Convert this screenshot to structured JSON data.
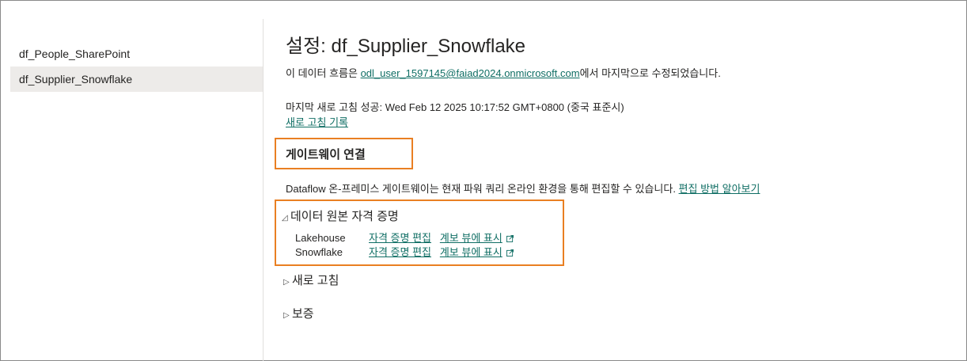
{
  "sidebar": {
    "items": [
      {
        "label": "df_People_SharePoint"
      },
      {
        "label": "df_Supplier_Snowflake"
      }
    ]
  },
  "main": {
    "title_prefix": "설정",
    "title_sep": ":",
    "title_name": "df_Supplier_Snowflake",
    "modified_pre": "이 데이터 흐름은 ",
    "modified_user": "odl_user_1597145@faiad2024.onmicrosoft.com",
    "modified_post": "에서 마지막으로 수정되었습니다.",
    "last_refresh": "마지막 새로 고침 성공: Wed Feb 12 2025 10:17:52 GMT+0800 (중국 표준시)",
    "refresh_history_link": "새로 고침 기록"
  },
  "gateway": {
    "title": "게이트웨이 연결",
    "desc": "Dataflow 온-프레미스 게이트웨이는 현재 파워 쿼리 온라인 환경을 통해 편집할 수 있습니다. ",
    "learn_link": "편집 방법 알아보기"
  },
  "credentials": {
    "header": "데이터 원본 자격 증명",
    "toggle": "◿",
    "rows": [
      {
        "name": "Lakehouse",
        "edit": "자격 증명 편집",
        "lineage": "계보 뷰에 표시"
      },
      {
        "name": "Snowflake",
        "edit": "자격 증명 편집",
        "lineage": "계보 뷰에 표시"
      }
    ]
  },
  "refresh_section": {
    "header": "새로 고침",
    "toggle": "▷"
  },
  "endorse_section": {
    "header": "보증",
    "toggle": "▷"
  },
  "colors": {
    "accent_link": "#0f6e64",
    "highlight_border": "#e97f22",
    "selected_bg": "#edebe9"
  },
  "icons": {
    "external_link": "external-link-icon"
  }
}
